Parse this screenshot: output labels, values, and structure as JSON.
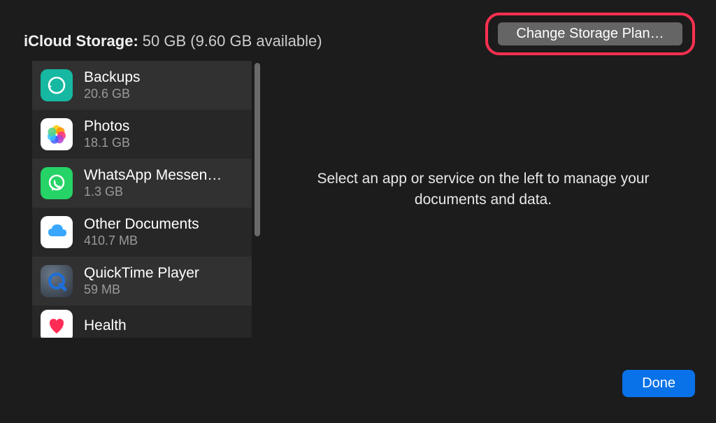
{
  "header": {
    "storage_label": "iCloud Storage:",
    "storage_value": "50 GB (9.60 GB available)",
    "change_plan_label": "Change Storage Plan…"
  },
  "items": [
    {
      "icon": "backup-icon",
      "title": "Backups",
      "size": "20.6 GB"
    },
    {
      "icon": "photos-icon",
      "title": "Photos",
      "size": "18.1 GB"
    },
    {
      "icon": "whatsapp-icon",
      "title": "WhatsApp Messen…",
      "size": "1.3 GB"
    },
    {
      "icon": "icloud-drive-icon",
      "title": "Other Documents",
      "size": "410.7 MB"
    },
    {
      "icon": "quicktime-icon",
      "title": "QuickTime Player",
      "size": "59 MB"
    },
    {
      "icon": "health-icon",
      "title": "Health",
      "size": ""
    }
  ],
  "detail": {
    "placeholder": "Select an app or service on the left to manage your documents and data."
  },
  "footer": {
    "done_label": "Done"
  }
}
